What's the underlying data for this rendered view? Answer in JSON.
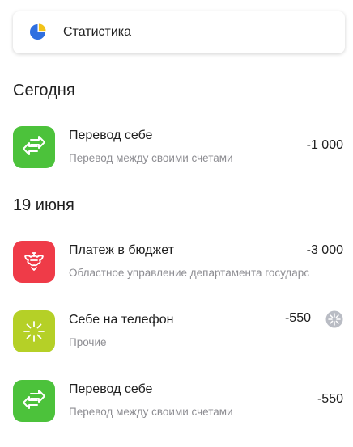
{
  "stats": {
    "label": "Статистика",
    "icon": "pie-chart-icon"
  },
  "colors": {
    "green": "#4cc23b",
    "red": "#ef3b48",
    "lime": "#b5d027",
    "pie_blue": "#2f6fe0",
    "pie_yellow": "#f2c318",
    "text_secondary": "#8e8e93"
  },
  "sections": [
    {
      "title": "Сегодня",
      "transactions": [
        {
          "title": "Перевод себе",
          "subtitle": "Перевод между своими счетами",
          "amount": "-1 000",
          "icon": "transfer-arrows-icon"
        }
      ]
    },
    {
      "title": "19 июня",
      "transactions": [
        {
          "title": "Платеж в бюджет",
          "subtitle": "Областное управление департамента государс",
          "amount": "-3 000",
          "icon": "coat-of-arms-icon"
        },
        {
          "title": "Себе на телефон",
          "subtitle": "Прочие",
          "amount": "-550",
          "icon": "operator-logo-icon",
          "badge": "bonus-badge-icon"
        },
        {
          "title": "Перевод себе",
          "subtitle": "Перевод между своими счетами",
          "amount": "-550",
          "icon": "transfer-arrows-icon"
        }
      ]
    }
  ]
}
